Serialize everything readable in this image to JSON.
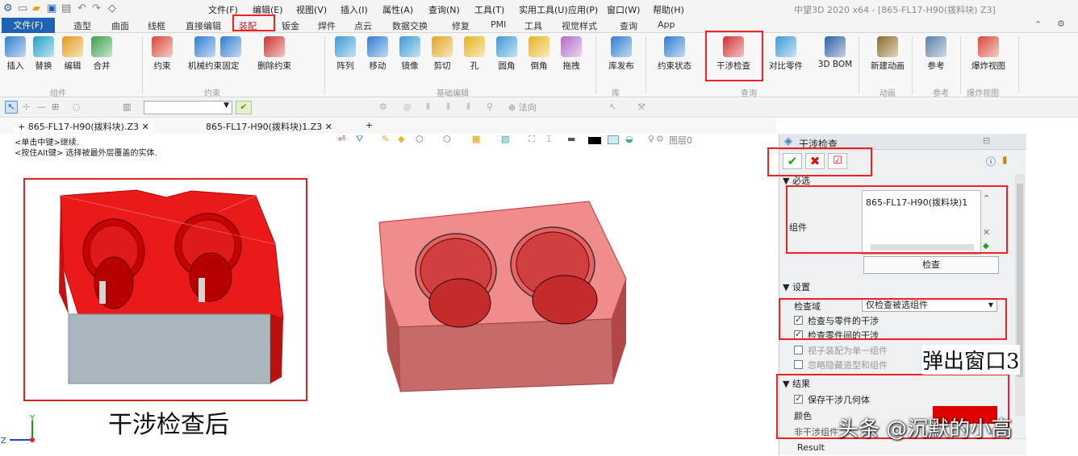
{
  "titlebar": {
    "quick_icons": [
      "app-logo-icon",
      "new-icon",
      "open-icon",
      "save-icon",
      "print-icon",
      "undo-icon",
      "redo-icon",
      "shape-icon"
    ],
    "menus": [
      "文件(F)",
      "编辑(E)",
      "视图(V)",
      "插入(I)",
      "属性(A)",
      "查询(N)",
      "工具(T)",
      "实用工具(U)",
      "应用(P)",
      "窗口(W)",
      "帮助(H)"
    ],
    "window_title": "中望3D 2020 x64 - [865-FL17-H90(拨料块) Z3]"
  },
  "ribbon_tabs": [
    "文件(F)",
    "造型",
    "曲面",
    "线框",
    "直接编辑",
    "装配",
    "钣金",
    "焊件",
    "点云",
    "数据交换",
    "修复",
    "PMI",
    "工具",
    "视觉样式",
    "查询",
    "App"
  ],
  "active_tab": "装配",
  "ribbon": {
    "buttons": [
      {
        "label": "插入",
        "icon": "insert-component-icon"
      },
      {
        "label": "替换",
        "icon": "replace-icon"
      },
      {
        "label": "编辑",
        "icon": "edit-icon"
      },
      {
        "label": "合并",
        "icon": "merge-icon"
      },
      {
        "label": "约束",
        "icon": "constraint-icon"
      },
      {
        "label": "机械约束",
        "icon": "mechanical-constraint-icon"
      },
      {
        "label": "固定",
        "icon": "fix-icon"
      },
      {
        "label": "删除约束",
        "icon": "delete-constraint-icon"
      },
      {
        "label": "阵列",
        "icon": "pattern-icon"
      },
      {
        "label": "移动",
        "icon": "move-icon"
      },
      {
        "label": "镜像",
        "icon": "mirror-icon"
      },
      {
        "label": "剪切",
        "icon": "cut-icon"
      },
      {
        "label": "孔",
        "icon": "hole-icon"
      },
      {
        "label": "圆角",
        "icon": "fillet-icon"
      },
      {
        "label": "倒角",
        "icon": "chamfer-icon"
      },
      {
        "label": "拖拽",
        "icon": "drag-icon"
      },
      {
        "label": "库发布",
        "icon": "library-publish-icon"
      },
      {
        "label": "约束状态",
        "icon": "constraint-status-icon"
      },
      {
        "label": "干涉检查",
        "icon": "interference-check-icon"
      },
      {
        "label": "对比零件",
        "icon": "compare-parts-icon"
      },
      {
        "label": "3D BOM",
        "icon": "bom-icon"
      },
      {
        "label": "新建动画",
        "icon": "new-animation-icon"
      },
      {
        "label": "参考",
        "icon": "reference-icon"
      },
      {
        "label": "爆炸视图",
        "icon": "explode-view-icon"
      }
    ],
    "groups": [
      "组件",
      "约束",
      "基础编辑",
      "库",
      "查询",
      "动画",
      "参考",
      "爆炸视图"
    ]
  },
  "toolbar2": {
    "filter_value": "",
    "direction_placeholder": "法向"
  },
  "doc_tabs": [
    "+ 865-FL17-H90(拨料块).Z3 ✕",
    "865-FL17-H90(拨料块)1.Z3 ✕",
    "+"
  ],
  "viewport": {
    "hints": [
      "<单击中键>继续.",
      "<按住Alt键> 选择被最外层覆盖的实体."
    ],
    "caption_left": "干涉检查后",
    "layer_label": "图层0"
  },
  "dialog": {
    "title": "干涉检查",
    "sections": {
      "required": "必选",
      "settings": "设置",
      "result": "结果"
    },
    "component_label": "组件",
    "component_value": "865-FL17-H90(拨料块)1",
    "check_button": "检查",
    "domain_label": "检查域",
    "domain_value": "仅检查被选组件",
    "options": [
      {
        "label": "检查与零件的干涉",
        "checked": true
      },
      {
        "label": "检查零件间的干涉",
        "checked": true
      },
      {
        "label": "视子装配为单一组件",
        "checked": false
      },
      {
        "label": "忽略隐藏造型和组件",
        "checked": false
      }
    ],
    "save_geometry": "保存干涉几何体",
    "color_label": "颜色",
    "non_interference": "非干涉组件",
    "result_label": "Result",
    "color_value": "#e00000"
  },
  "annotations": {
    "popup_caption": "弹出窗口3",
    "watermark": "头条 @沉默的小高"
  }
}
